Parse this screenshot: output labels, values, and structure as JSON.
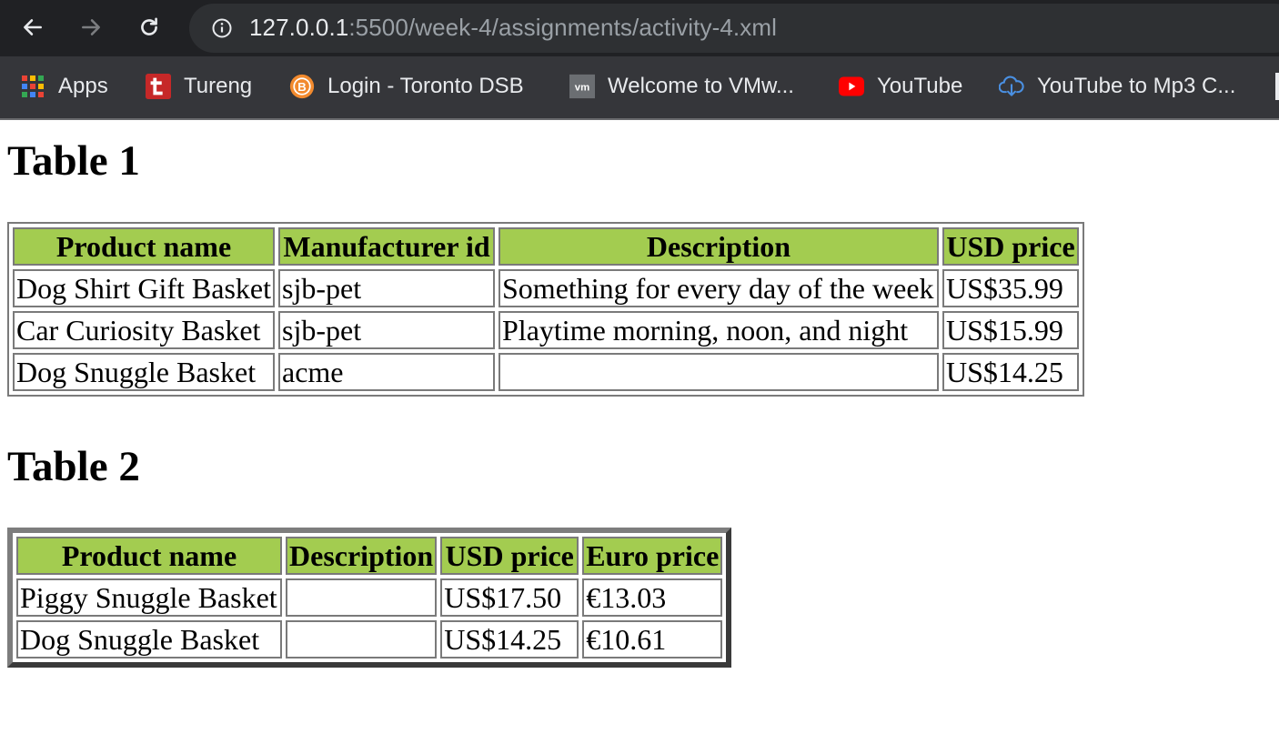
{
  "browser": {
    "url_host": "127.0.0.1",
    "url_rest": ":5500/week-4/assignments/activity-4.xml",
    "bookmarks": [
      {
        "label": "Apps",
        "icon": "apps-grid-icon"
      },
      {
        "label": "Tureng",
        "icon": "tureng-icon"
      },
      {
        "label": "Login - Toronto DSB",
        "icon": "brightspace-icon"
      },
      {
        "label": "Welcome to VMw...",
        "icon": "vmware-icon"
      },
      {
        "label": "YouTube",
        "icon": "youtube-icon"
      },
      {
        "label": "YouTube to Mp3 C...",
        "icon": "cloud-download-icon"
      }
    ]
  },
  "colors": {
    "header_bg": "#a3cc50",
    "toolbar": "#202124",
    "bookmarks_bar": "#35363a"
  },
  "table1": {
    "heading": "Table 1",
    "headers": [
      "Product name",
      "Manufacturer id",
      "Description",
      "USD price"
    ],
    "rows": [
      [
        "Dog Shirt Gift Basket",
        "sjb-pet",
        "Something for every day of the week",
        "US$35.99"
      ],
      [
        "Car Curiosity Basket",
        "sjb-pet",
        "Playtime morning, noon, and night",
        "US$15.99"
      ],
      [
        "Dog Snuggle Basket",
        "acme",
        "",
        "US$14.25"
      ]
    ]
  },
  "table2": {
    "heading": "Table 2",
    "headers": [
      "Product name",
      "Description",
      "USD price",
      "Euro price"
    ],
    "rows": [
      [
        "Piggy Snuggle Basket",
        "",
        "US$17.50",
        "€13.03"
      ],
      [
        "Dog Snuggle Basket",
        "",
        "US$14.25",
        "€10.61"
      ]
    ]
  }
}
